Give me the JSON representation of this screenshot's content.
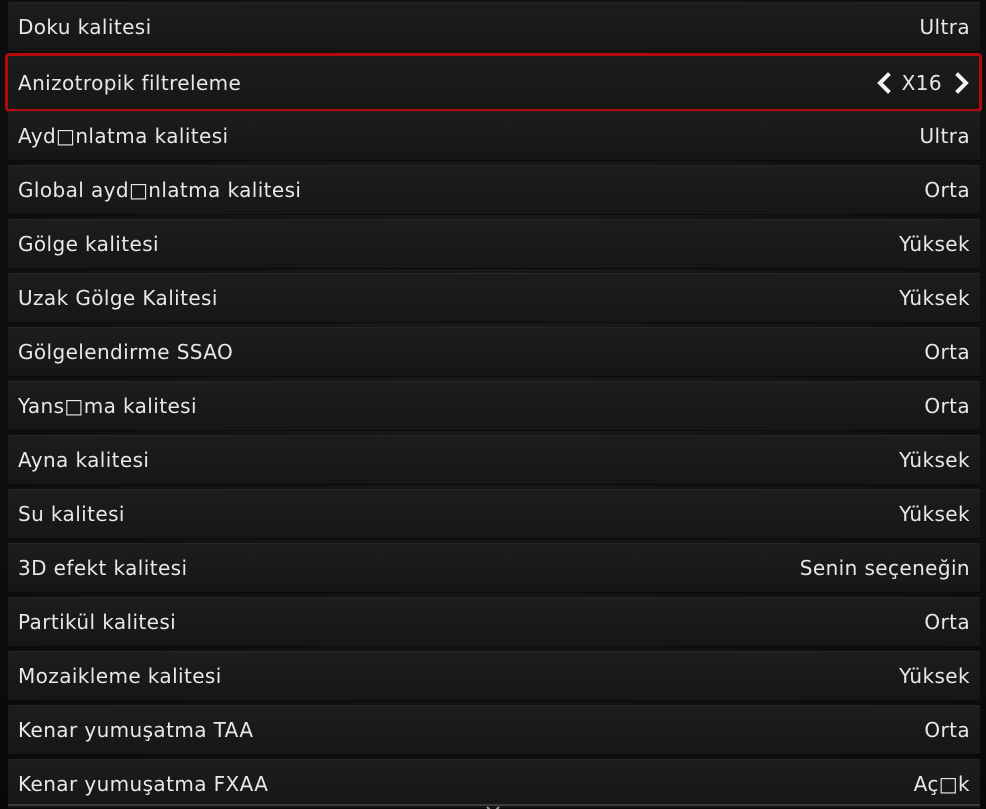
{
  "settings": {
    "rows": [
      {
        "label": "Doku kalitesi",
        "value": "Ultra"
      },
      {
        "label": "Anizotropik filtreleme",
        "value": "X16",
        "selected": true
      },
      {
        "label": "Ayd□nlatma kalitesi",
        "value": "Ultra"
      },
      {
        "label": "Global ayd□nlatma kalitesi",
        "value": "Orta"
      },
      {
        "label": "Gölge kalitesi",
        "value": "Yüksek"
      },
      {
        "label": "Uzak Gölge Kalitesi",
        "value": "Yüksek"
      },
      {
        "label": "Gölgelendirme SSAO",
        "value": "Orta"
      },
      {
        "label": "Yans□ma kalitesi",
        "value": "Orta"
      },
      {
        "label": "Ayna kalitesi",
        "value": "Yüksek"
      },
      {
        "label": "Su kalitesi",
        "value": "Yüksek"
      },
      {
        "label": "3D efekt kalitesi",
        "value": "Senin seçeneğin"
      },
      {
        "label": "Partikül kalitesi",
        "value": "Orta"
      },
      {
        "label": "Mozaikleme kalitesi",
        "value": "Yüksek"
      },
      {
        "label": "Kenar yumuşatma TAA",
        "value": "Orta"
      },
      {
        "label": "Kenar yumuşatma FXAA",
        "value": "Aç□k"
      }
    ]
  },
  "icons": {
    "left": "chevron-left-icon",
    "right": "chevron-right-icon",
    "scroll": "scroll-down-caret-icon"
  },
  "colors": {
    "highlight": "#b3090b",
    "text": "#e8e8e8",
    "row_bg": "#1b1b1b"
  }
}
